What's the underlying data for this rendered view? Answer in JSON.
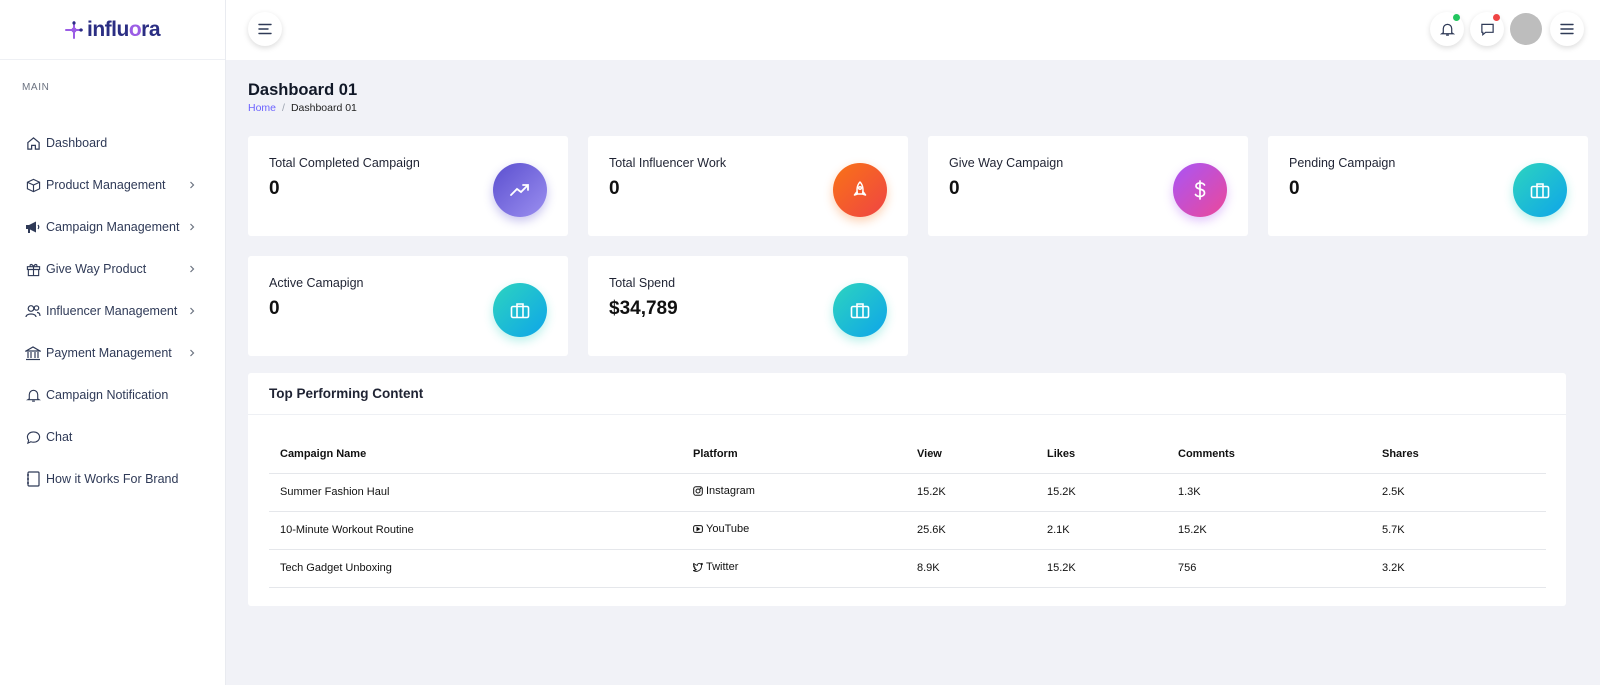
{
  "brand": {
    "name_a": "influ",
    "name_b": "o",
    "name_c": "ra"
  },
  "sidebar": {
    "caption": "MAIN",
    "items": [
      {
        "label": "Dashboard",
        "icon": "home-icon"
      },
      {
        "label": "Product Management",
        "icon": "box-icon"
      },
      {
        "label": "Campaign Management",
        "icon": "megaphone-icon"
      },
      {
        "label": "Give Way Product",
        "icon": "gift-icon"
      },
      {
        "label": "Influencer Management",
        "icon": "users-icon"
      },
      {
        "label": "Payment Management",
        "icon": "bank-icon"
      },
      {
        "label": "Campaign Notification",
        "icon": "bell-icon"
      },
      {
        "label": "Chat",
        "icon": "chat-icon"
      },
      {
        "label": "How it Works For Brand",
        "icon": "notebook-icon"
      }
    ]
  },
  "header": {
    "notification_dot_color": "#22c55e",
    "message_dot_color": "#ef4444"
  },
  "page": {
    "title": "Dashboard 01",
    "breadcrumb_home": "Home",
    "breadcrumb_sep": "/",
    "breadcrumb_current": "Dashboard 01"
  },
  "cards": [
    {
      "title": "Total Completed Campaign",
      "value": "0",
      "icon": "trending-up-icon",
      "gradient": [
        "#5b4fcf",
        "#9b8ff0"
      ]
    },
    {
      "title": "Total Influencer Work",
      "value": "0",
      "icon": "rocket-icon",
      "gradient": [
        "#f97316",
        "#ef4444"
      ]
    },
    {
      "title": "Give Way Campaign",
      "value": "0",
      "icon": "dollar-icon",
      "gradient": [
        "#a855f7",
        "#ec4899"
      ]
    },
    {
      "title": "Pending Campaign",
      "value": "0",
      "icon": "briefcase-icon",
      "gradient": [
        "#2dd4bf",
        "#0ea5e9"
      ]
    },
    {
      "title": "Active Camapign",
      "value": "0",
      "icon": "briefcase-icon",
      "gradient": [
        "#2dd4bf",
        "#0ea5e9"
      ]
    },
    {
      "title": "Total Spend",
      "value": "$34,789",
      "icon": "briefcase-icon",
      "gradient": [
        "#2dd4bf",
        "#0ea5e9"
      ]
    }
  ],
  "top_content": {
    "title": "Top Performing Content",
    "columns": [
      "Campaign Name",
      "Platform",
      "View",
      "Likes",
      "Comments",
      "Shares"
    ],
    "rows": [
      {
        "name": "Summer Fashion Haul",
        "platform": "Instagram",
        "platform_icon": "instagram-icon",
        "view": "15.2K",
        "likes": "15.2K",
        "comments": "1.3K",
        "shares": "2.5K"
      },
      {
        "name": "10-Minute Workout Routine",
        "platform": "YouTube",
        "platform_icon": "youtube-icon",
        "view": "25.6K",
        "likes": "2.1K",
        "comments": "15.2K",
        "shares": "5.7K"
      },
      {
        "name": "Tech Gadget Unboxing",
        "platform": "Twitter",
        "platform_icon": "twitter-icon",
        "view": "8.9K",
        "likes": "15.2K",
        "comments": "756",
        "shares": "3.2K"
      }
    ]
  }
}
